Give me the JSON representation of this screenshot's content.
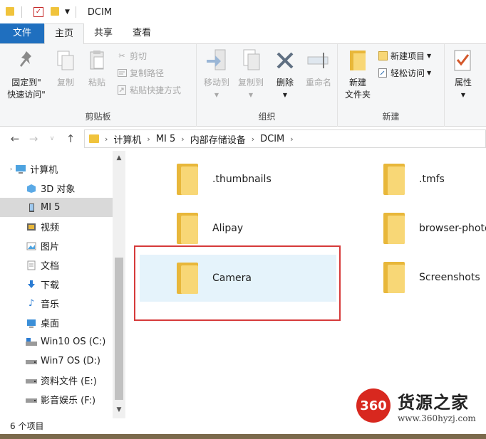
{
  "window": {
    "title": "DCIM"
  },
  "tabs": [
    {
      "label": "文件"
    },
    {
      "label": "主页"
    },
    {
      "label": "共享"
    },
    {
      "label": "查看"
    }
  ],
  "ribbon": {
    "clipboard": {
      "pin_label_1": "固定到\"",
      "pin_label_2": "快速访问\"",
      "copy_label": "复制",
      "paste_label": "粘贴",
      "cut_label": "剪切",
      "copy_path_label": "复制路径",
      "paste_shortcut_label": "粘贴快捷方式",
      "group_label": "剪贴板"
    },
    "organize": {
      "move_to_label": "移动到",
      "copy_to_label": "复制到",
      "delete_label": "删除",
      "rename_label": "重命名",
      "group_label": "组织"
    },
    "new": {
      "new_folder_label_1": "新建",
      "new_folder_label_2": "文件夹",
      "new_item_label": "新建项目",
      "easy_access_label": "轻松访问",
      "group_label": "新建"
    },
    "open": {
      "properties_label": "属性"
    }
  },
  "address": {
    "crumbs": [
      "计算机",
      "MI 5",
      "内部存储设备",
      "DCIM"
    ]
  },
  "sidebar": {
    "items": [
      {
        "label": "计算机"
      },
      {
        "label": "3D 对象"
      },
      {
        "label": "MI 5"
      },
      {
        "label": "视频"
      },
      {
        "label": "图片"
      },
      {
        "label": "文档"
      },
      {
        "label": "下载"
      },
      {
        "label": "音乐"
      },
      {
        "label": "桌面"
      },
      {
        "label": "Win10 OS (C:)"
      },
      {
        "label": "Win7 OS (D:)"
      },
      {
        "label": "资料文件 (E:)"
      },
      {
        "label": "影音娱乐 (F:)"
      }
    ]
  },
  "folders": [
    {
      "name": ".thumbnails"
    },
    {
      "name": ".tmfs"
    },
    {
      "name": "Alipay"
    },
    {
      "name": "browser-photo"
    },
    {
      "name": "Camera"
    },
    {
      "name": "Screenshots"
    }
  ],
  "status": {
    "count_text": "6 个项目"
  },
  "watermark": {
    "badge": "360",
    "title": "货源之家",
    "url": "www.360hyzj.com"
  },
  "colors": {
    "accent": "#1f6fbf",
    "highlight_border": "#d63a3a",
    "selection": "#e5f3fb",
    "folder": "#f8d776"
  }
}
